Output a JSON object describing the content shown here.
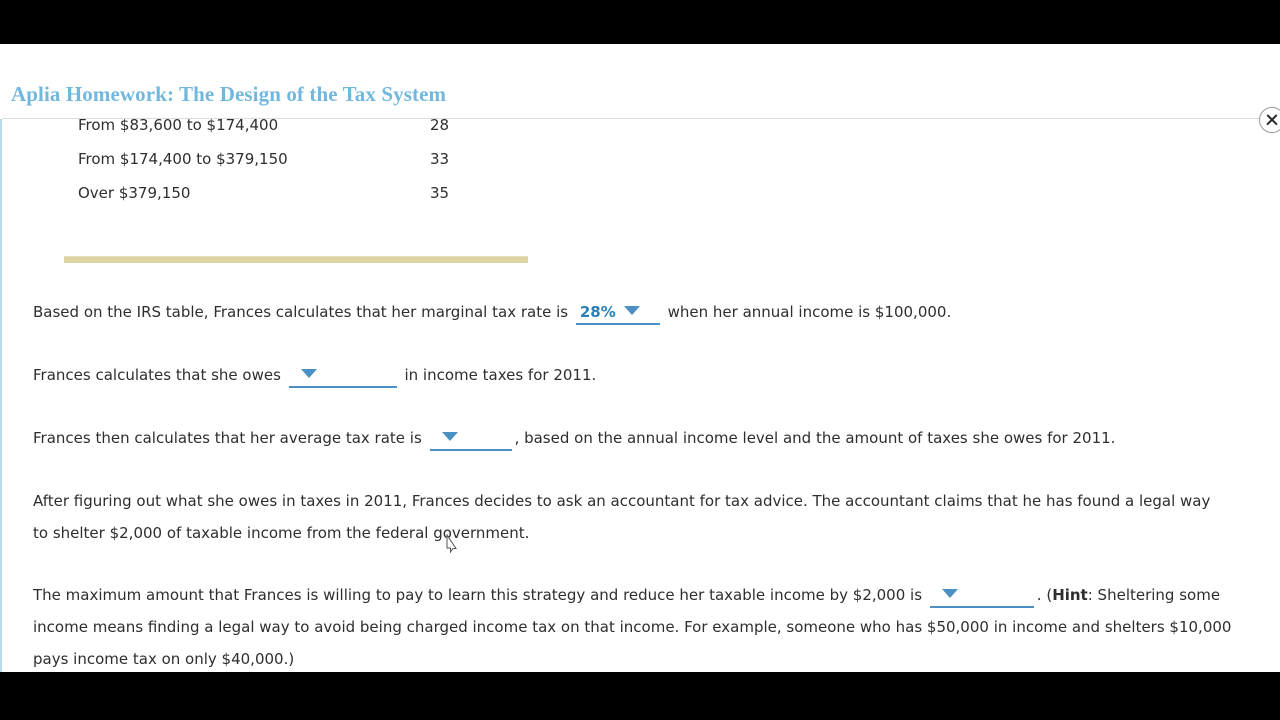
{
  "window": {
    "title": "Aplia Homework: The Design of the Tax System",
    "close_label": "Close"
  },
  "tax_table": {
    "rows": [
      {
        "bracket": "From $83,600 to $174,400",
        "rate": "28"
      },
      {
        "bracket": "From $174,400 to $379,150",
        "rate": "33"
      },
      {
        "bracket": "Over $379,150",
        "rate": "35"
      }
    ]
  },
  "questions": {
    "q1": {
      "text_before": "Based on the IRS table, Frances calculates that her marginal tax rate is",
      "dropdown_value": "28%",
      "text_after": "when her annual income is $100,000."
    },
    "q2": {
      "text_before": "Frances calculates that she owes",
      "dropdown_value": "",
      "text_after": "in income taxes for 2011."
    },
    "q3": {
      "text_before": "Frances then calculates that her average tax rate is",
      "dropdown_value": "",
      "text_after": ", based on the annual income level and the amount of taxes she owes for 2011."
    },
    "q4": {
      "text": "After figuring out what she owes in taxes in 2011, Frances decides to ask an accountant for tax advice. The accountant claims that he has found a legal way to shelter $2,000 of taxable income from the federal government."
    },
    "q5": {
      "text_before": "The maximum amount that Frances is willing to pay to learn this strategy and reduce her taxable income by $2,000 is",
      "dropdown_value": "",
      "text_mid_punct": ". (",
      "hint_label": "Hint",
      "text_after": ": Sheltering some income means finding a legal way to avoid being charged income tax on that income. For example, someone who has $50,000 in income and shelters $10,000 pays income tax on only $40,000.)"
    }
  },
  "colors": {
    "title": "#72b8dd",
    "dropdown_accent": "#4a90c4",
    "dropdown_text": "#2b7fb8",
    "table_bar": "#ddd5a3",
    "body_text": "#2e2e2e"
  }
}
